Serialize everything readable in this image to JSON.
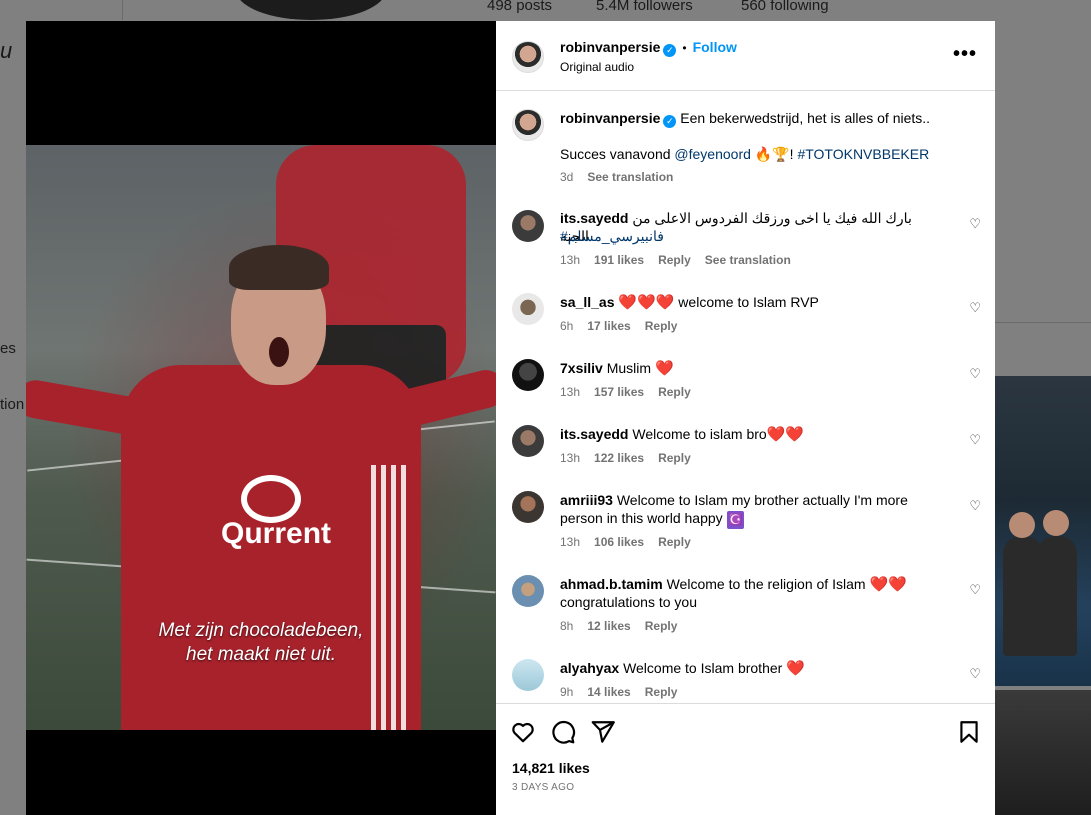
{
  "background": {
    "stats": [
      "498 posts",
      "5.4M followers",
      "560 following"
    ],
    "left_fragments": [
      "u",
      "es",
      "tion"
    ]
  },
  "video": {
    "sponsor": "Qurrent",
    "subtitle_line1": "Met zijn chocoladebeen,",
    "subtitle_line2": "het maakt niet uit."
  },
  "header": {
    "username": "robinvanpersie",
    "separator": "•",
    "follow_label": "Follow",
    "audio": "Original audio",
    "more": "•••"
  },
  "caption": {
    "username": "robinvanpersie",
    "text": "Een bekerwedstrijd, het is alles of niets..",
    "line2_prefix": "Succes vanavond ",
    "mention": "@feyenoord",
    "emojis": "🔥🏆",
    "line2_suffix": "! ",
    "hashtag": "#TOTOKNVBBEKER",
    "time": "3d",
    "translate": "See translation"
  },
  "comments": [
    {
      "username": "its.sayedd",
      "text": "بارك الله فيك يا اخى ورزقك الفردوس الاعلى من الجنه",
      "text2": "#فانبيرسي_مسلم",
      "time": "13h",
      "likes": "191 likes",
      "reply": "Reply",
      "translate": "See translation"
    },
    {
      "username": "sa_ll_as",
      "hearts": "❤️❤️❤️",
      "text": " welcome to Islam RVP",
      "time": "6h",
      "likes": "17 likes",
      "reply": "Reply"
    },
    {
      "username": "7xsiliv",
      "text": "Muslim ",
      "hearts": "❤️",
      "time": "13h",
      "likes": "157 likes",
      "reply": "Reply"
    },
    {
      "username": "its.sayedd",
      "text": "Welcome to islam bro",
      "hearts": "❤️❤️",
      "time": "13h",
      "likes": "122 likes",
      "reply": "Reply"
    },
    {
      "username": "amriii93",
      "text": "Welcome to Islam my brother actually I'm more",
      "text2": "person in this world happy ",
      "emoji": "☪️",
      "time": "13h",
      "likes": "106 likes",
      "reply": "Reply"
    },
    {
      "username": "ahmad.b.tamim",
      "text": "Welcome to the religion of Islam ",
      "hearts": "❤️❤️",
      "text2": "congratulations to you",
      "time": "8h",
      "likes": "12 likes",
      "reply": "Reply"
    },
    {
      "username": "alyahyax",
      "text": "Welcome to Islam brother ",
      "hearts": "❤️",
      "time": "9h",
      "likes": "14 likes",
      "reply": "Reply"
    }
  ],
  "footer": {
    "likes": "14,821 likes",
    "date": "3 DAYS AGO"
  }
}
